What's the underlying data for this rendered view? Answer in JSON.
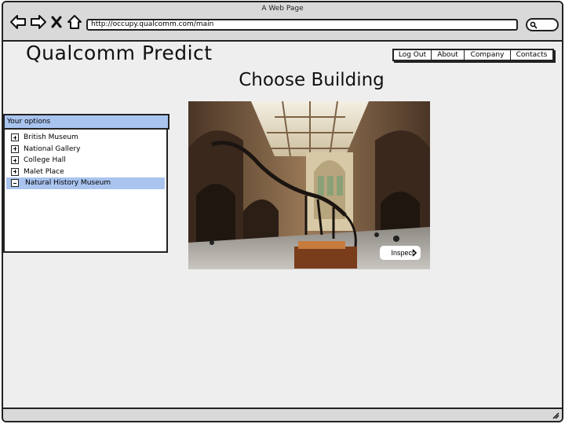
{
  "window": {
    "title": "A Web Page"
  },
  "browser": {
    "url": "http://occupy.qualcomm.com/main",
    "icons": [
      "back-arrow-icon",
      "forward-arrow-icon",
      "close-x-icon",
      "home-icon",
      "search-icon"
    ]
  },
  "app": {
    "title": "Qualcomm Predict"
  },
  "topnav": {
    "items": [
      {
        "label": "Log Out"
      },
      {
        "label": "About"
      },
      {
        "label": "Company"
      },
      {
        "label": "Contacts"
      }
    ]
  },
  "page": {
    "heading": "Choose Building"
  },
  "options": {
    "header": "Your options",
    "items": [
      {
        "label": "British Museum",
        "expanded": false
      },
      {
        "label": "National Gallery",
        "expanded": false
      },
      {
        "label": "College Hall",
        "expanded": false
      },
      {
        "label": "Malet Place",
        "expanded": false
      },
      {
        "label": "Natural History Museum",
        "expanded": true,
        "selected": true
      }
    ]
  },
  "hero": {
    "inspect_label": "Inspect"
  },
  "colors": {
    "selection": "#a9c4ee",
    "frame": "#222222",
    "canvas": "#eeeeee"
  }
}
